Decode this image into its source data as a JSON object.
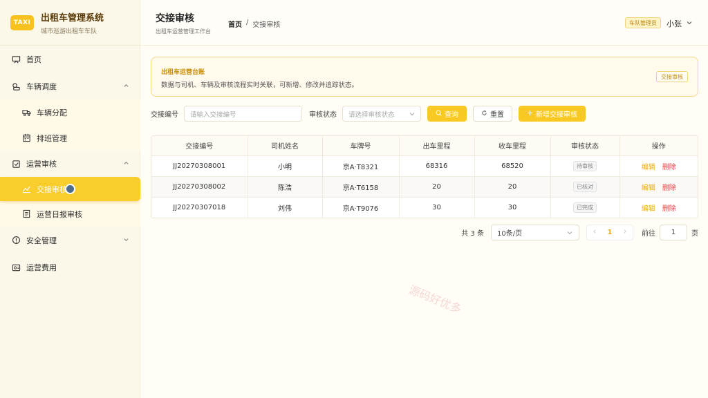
{
  "brand": {
    "logo": "TAXI",
    "title": "出租车管理系统",
    "subtitle": "城市巡游出租车车队"
  },
  "sidebar": {
    "items": [
      {
        "label": "首页",
        "icon": "dashboard-icon"
      },
      {
        "label": "车辆调度",
        "icon": "dispatch-icon"
      },
      {
        "label": "车辆分配",
        "icon": "truck-icon"
      },
      {
        "label": "排班管理",
        "icon": "calendar-icon"
      },
      {
        "label": "运营审核",
        "icon": "checkbox-icon"
      },
      {
        "label": "交接审核",
        "icon": "handover-icon"
      },
      {
        "label": "运营日报审核",
        "icon": "report-icon"
      },
      {
        "label": "安全管理",
        "icon": "alert-icon"
      },
      {
        "label": "运营费用",
        "icon": "fee-icon"
      }
    ]
  },
  "header": {
    "title": "交接审核",
    "subtitle": "出租车运营管理工作台",
    "breadcrumb": [
      "首页",
      "/",
      "交接审核"
    ],
    "role": "车队管理员",
    "user": "小张"
  },
  "info_card": {
    "title": "出租车运营台账",
    "desc": "数据与司机、车辆及审核流程实时关联，可新增、修改并追踪状态。",
    "tag": "交接审核"
  },
  "search": {
    "code_label": "交接编号",
    "code_placeholder": "请输入交接编号",
    "status_label": "审核状态",
    "status_placeholder": "请选择审核状态",
    "query": "查询",
    "reset": "重置",
    "add": "新增交接审核"
  },
  "table": {
    "headers": [
      "交接编号",
      "司机姓名",
      "车牌号",
      "出车里程",
      "收车里程",
      "审核状态",
      "操作"
    ],
    "rows": [
      {
        "code": "JJ20270308001",
        "driver": "小明",
        "plate": "京A·T8321",
        "out": "68316",
        "in": "68520",
        "status": "待审核"
      },
      {
        "code": "JJ20270308002",
        "driver": "陈浩",
        "plate": "京A·T6158",
        "out": "20",
        "in": "20",
        "status": "已核对"
      },
      {
        "code": "JJ20270307018",
        "driver": "刘伟",
        "plate": "京A·T9076",
        "out": "30",
        "in": "30",
        "status": "已完成"
      }
    ],
    "edit": "编辑",
    "delete": "删除"
  },
  "pager": {
    "total": "共 3 条",
    "size": "10条/页",
    "page": "1",
    "goto_label": "前往",
    "goto_value": "1",
    "goto_suffix": "页"
  },
  "watermark": "源码好优多",
  "colors": {
    "accent": "#f9c923",
    "danger": "#e64646",
    "sidebar": "#fbf7e9"
  }
}
